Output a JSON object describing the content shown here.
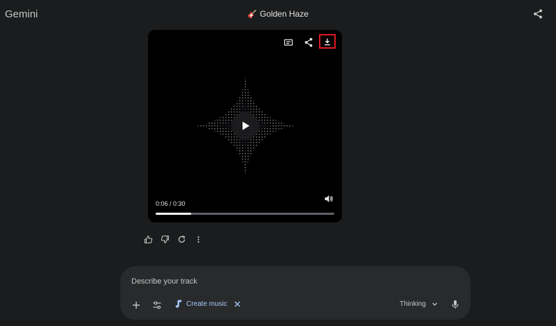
{
  "app": {
    "title": "Gemini"
  },
  "header": {
    "chat_title": "Golden Haze",
    "title_icon": "guitar-icon"
  },
  "player": {
    "current_time": "0:06",
    "duration": "0:30",
    "time_display": "0:06 / 0:30",
    "progress_fraction": 0.2,
    "controls": [
      "captions-icon",
      "share-icon",
      "download-icon",
      "play-icon",
      "volume-icon"
    ]
  },
  "response_actions": [
    "thumbs-up-icon",
    "thumbs-down-icon",
    "regenerate-icon",
    "more-vert-icon"
  ],
  "composer": {
    "placeholder": "Describe your track",
    "chip_label": "Create music",
    "model_label": "Thinking"
  },
  "colors": {
    "background": "#1b1c1d",
    "composer": "#282a2c",
    "chip_text": "#a8c7fa",
    "highlight": "#e01b24"
  }
}
